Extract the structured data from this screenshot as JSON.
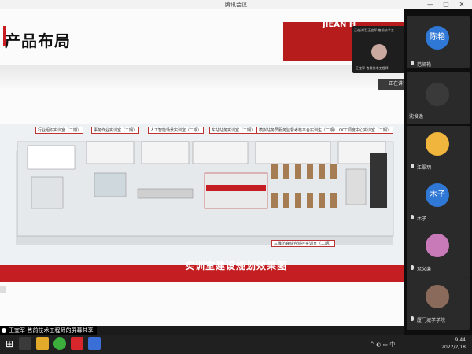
{
  "window": {
    "title": "腾讯会议",
    "controls": [
      "—",
      "□",
      "✕"
    ]
  },
  "slide": {
    "heading": "产品布局",
    "banner_text": "JIEAN H",
    "banner_sub": "",
    "room_labels": [
      "行业组织实训室（二期）",
      "事务作业实训室（二期）",
      "人工智能场景实训室（二期）",
      "车站站务实训室（二期）",
      "模拟站务员服务监督考核平台实训生（二期）",
      "OCC调度中心实训室（二期）",
      "三维仿真综合监控实训室（二期）"
    ],
    "caption": "实训室建设规划效果图"
  },
  "share_label": "王宜军-售前技术工程师的屏幕共享",
  "speaking_banner": "正在讲话：王宜军-售前技术工...",
  "floating_card": {
    "header": "正在讲话 王宜军-售前技术工",
    "name": "王宜军-售前技术工程师"
  },
  "participants": [
    {
      "avatar_text": "陈艳",
      "name": "范凯艳",
      "color": "#2f78d6"
    },
    {
      "avatar_text": "",
      "name": "沈俊逸",
      "color": "#3a3a3a"
    },
    {
      "avatar_text": "",
      "name": "江翠玥",
      "color": "#f0b53c"
    },
    {
      "avatar_text": "木子",
      "name": "木子",
      "color": "#2f78d6"
    },
    {
      "avatar_text": "",
      "name": "众义楽",
      "color": "#c87ab8"
    },
    {
      "avatar_text": "",
      "name": "厦门城学学院",
      "color": "#8a6a5a"
    }
  ],
  "taskbar": {
    "time": "9:44",
    "date": "2022/2/18",
    "tray": "^ ◐ ▭ 中"
  },
  "colors": {
    "accent_red": "#c41e22",
    "sidebar_bg": "#0e0e0e",
    "tile_bg": "#2a2a2a"
  }
}
